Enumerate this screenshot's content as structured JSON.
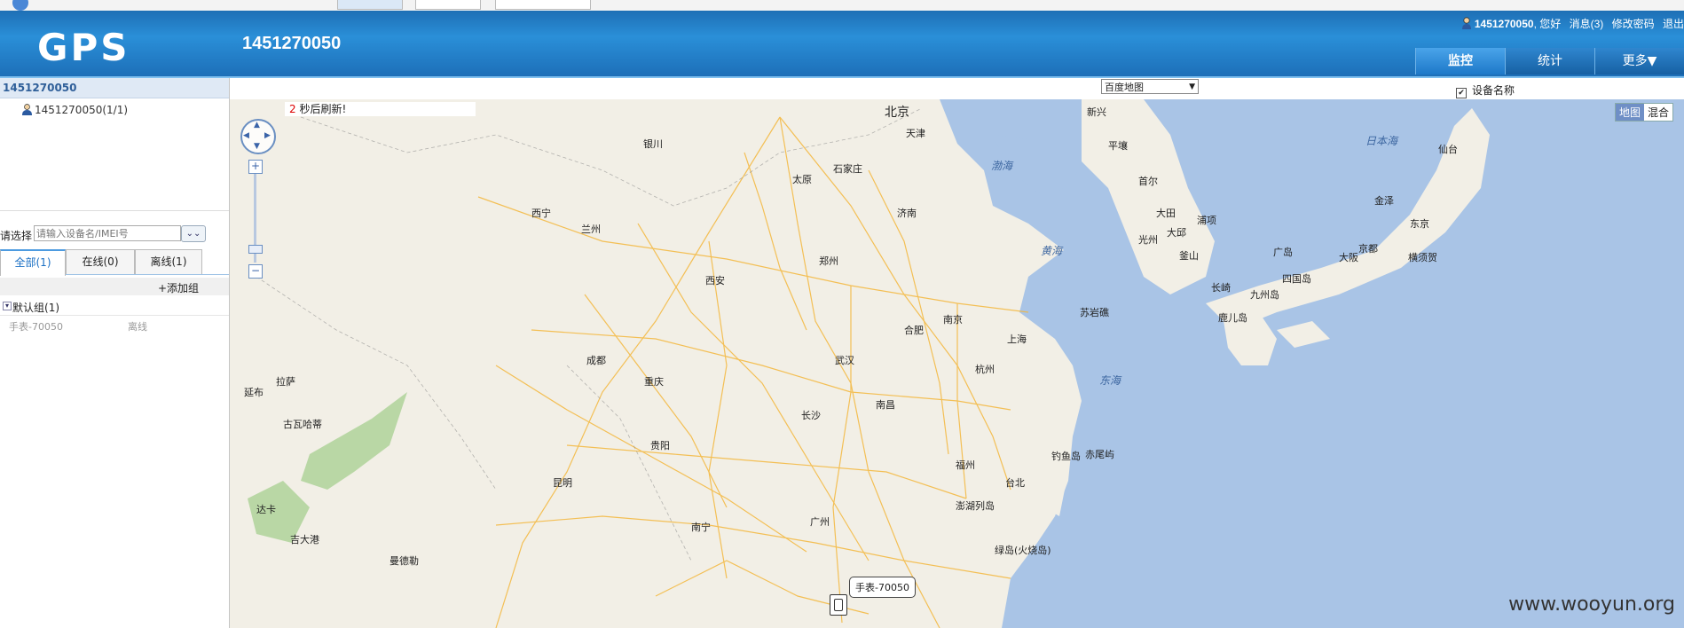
{
  "header": {
    "logo": "GPS",
    "account": "1451270050",
    "user_greeting_name": "1451270050",
    "user_greeting_suffix": ", 您好",
    "messages": "消息(3)",
    "change_password": "修改密码",
    "logout": "退出"
  },
  "nav_tabs": [
    "监控",
    "统计",
    "更多▼"
  ],
  "sidebar": {
    "title": "1451270050",
    "tree_node": "1451270050(1/1)",
    "search_label": "请选择",
    "search_placeholder": "请输入设备名/IMEI号",
    "tabs": [
      "全部(1)",
      "在线(0)",
      "离线(1)"
    ],
    "add_group": "+添加组",
    "group": {
      "name": "默认组",
      "count": "(1)"
    },
    "devices": [
      {
        "name": "手表-70050",
        "status": "离线"
      }
    ]
  },
  "map_toolbar": {
    "map_type": "百度地图",
    "show_device_name": "设备名称",
    "show_device_name_checked": true
  },
  "map": {
    "refresh_count": "2",
    "refresh_text": "秒后刷新!",
    "type_map": "地图",
    "type_hybrid": "混合",
    "cities": [
      "北京",
      "天津",
      "银川",
      "太原",
      "石家庄",
      "济南",
      "西宁",
      "兰州",
      "郑州",
      "西安",
      "合肥",
      "南京",
      "上海",
      "成都",
      "重庆",
      "武汉",
      "杭州",
      "拉萨",
      "长沙",
      "南昌",
      "贵阳",
      "福州",
      "台北",
      "昆明",
      "南宁",
      "广州",
      "平壤",
      "首尔",
      "大田",
      "光州",
      "大邱",
      "釜山",
      "浦项",
      "金泽",
      "京都",
      "大阪",
      "东京",
      "横须贺",
      "仙台",
      "四国岛",
      "九州岛",
      "长崎",
      "鹿儿岛",
      "广岛",
      "苏岩礁",
      "钓鱼岛",
      "赤尾屿",
      "澎湖列岛",
      "绿岛(火烧岛)",
      "吉大港",
      "古瓦哈蒂",
      "达卡",
      "延布",
      "曼德勒",
      "新兴",
      "渤海",
      "黄海",
      "东海",
      "日本海"
    ],
    "device_label": "手表-70050"
  },
  "watermark": "www.wooyun.org"
}
